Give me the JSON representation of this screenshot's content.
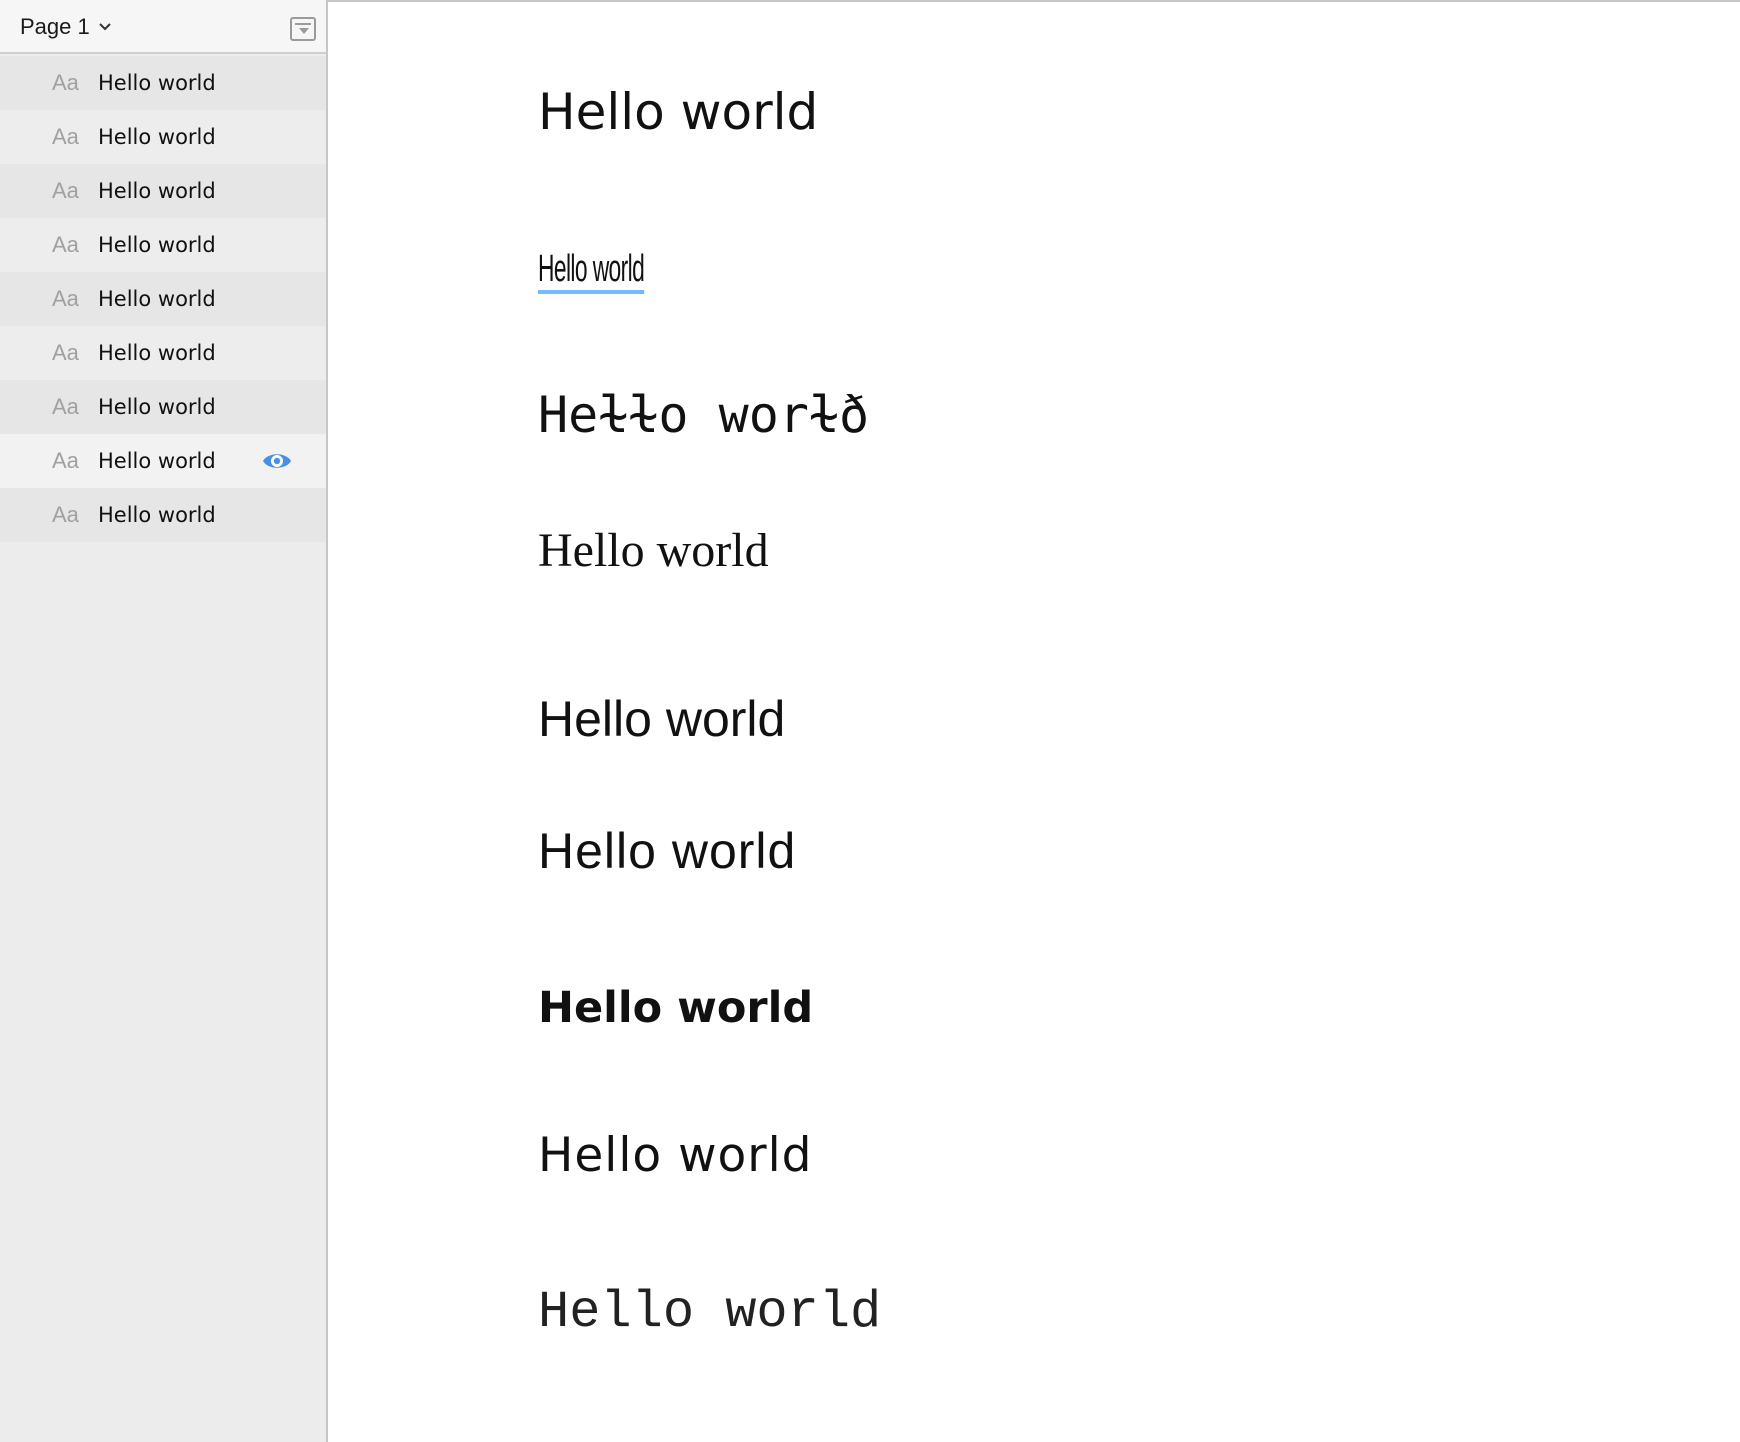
{
  "sidebar": {
    "page_selector": {
      "label": "Page 1",
      "icon": "chevron-down-icon"
    },
    "collapse_icon": "collapse-panel-icon",
    "layers": [
      {
        "icon_text": "Aa",
        "label": "Hello world"
      },
      {
        "icon_text": "Aa",
        "label": "Hello world"
      },
      {
        "icon_text": "Aa",
        "label": "Hello world"
      },
      {
        "icon_text": "Aa",
        "label": "Hello world"
      },
      {
        "icon_text": "Aa",
        "label": "Hello world"
      },
      {
        "icon_text": "Aa",
        "label": "Hello world"
      },
      {
        "icon_text": "Aa",
        "label": "Hello world"
      },
      {
        "icon_text": "Aa",
        "label": "Hello world",
        "visibility_icon": "eye-icon"
      },
      {
        "icon_text": "Aa",
        "label": "Hello world"
      }
    ]
  },
  "canvas": {
    "samples": [
      "Hello world",
      "Hello world",
      "Heɫɫo worɫð",
      "Hello world",
      "Hello world",
      "Hello world",
      "Hello world",
      "Hello world",
      "Hello world"
    ]
  },
  "colors": {
    "sidebar_bg": "#ececec",
    "accent_blue": "#4a90e2",
    "text": "#111111",
    "icon_gray": "#a0a0a0"
  }
}
